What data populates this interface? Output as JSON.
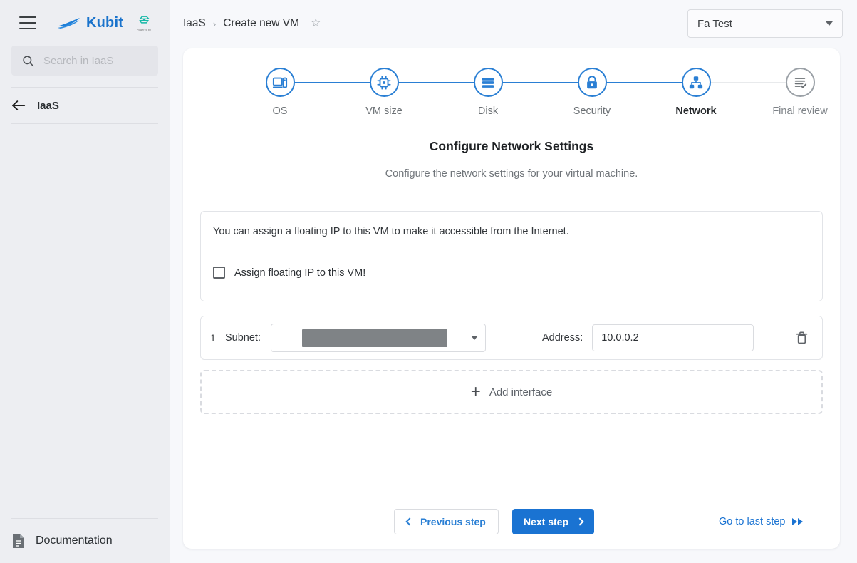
{
  "sidebar": {
    "brand": "Kubit",
    "partner_caption": "Powered by",
    "search_placeholder": "Search in IaaS",
    "nav_item": "IaaS",
    "documentation": "Documentation"
  },
  "topbar": {
    "breadcrumb_root": "IaaS",
    "breadcrumb_sep": "›",
    "breadcrumb_current": "Create new VM",
    "star": "☆",
    "project": "Fa Test"
  },
  "stepper": {
    "steps": [
      {
        "label": "OS",
        "icon": "monitor-icon",
        "state": "done"
      },
      {
        "label": "VM size",
        "icon": "cpu-icon",
        "state": "done"
      },
      {
        "label": "Disk",
        "icon": "storage-icon",
        "state": "done"
      },
      {
        "label": "Security",
        "icon": "lock-icon",
        "state": "done"
      },
      {
        "label": "Network",
        "icon": "network-icon",
        "state": "current"
      },
      {
        "label": "Final review",
        "icon": "review-icon",
        "state": "inactive"
      }
    ]
  },
  "main": {
    "title": "Configure Network Settings",
    "subtitle": "Configure the network settings for your virtual machine.",
    "floating_ip_note": "You can assign a floating IP to this VM to make it accessible from the Internet.",
    "floating_ip_checkbox_label": "Assign floating IP to this VM!",
    "floating_ip_checked": false
  },
  "interfaces": {
    "rows": [
      {
        "index": "1",
        "subnet_label": "Subnet:",
        "subnet_value": "",
        "subnet_redacted": true,
        "address_label": "Address:",
        "address_value": "10.0.0.2",
        "delete_icon": "trash-icon"
      }
    ],
    "add_label": "Add interface",
    "add_icon": "plus-icon"
  },
  "footer": {
    "previous": "Previous step",
    "next": "Next step",
    "go_last": "Go to last step"
  },
  "colors": {
    "accent": "#1a73d2",
    "step_active": "#2a7fd4",
    "step_inactive": "#9aa0a6",
    "sidebar_bg": "#edeef2",
    "page_bg": "#f7f8fb",
    "redaction": "#7f8386"
  }
}
